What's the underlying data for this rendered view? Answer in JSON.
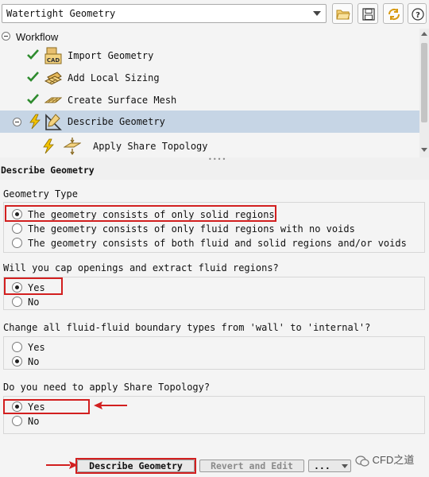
{
  "toolbar": {
    "workflow_select_value": "Watertight Geometry",
    "icons": [
      "open-folder-icon",
      "save-icon",
      "refresh-icon",
      "help-icon"
    ]
  },
  "tree": {
    "root_label": "Workflow",
    "items": [
      {
        "label": "Import Geometry",
        "status": "done",
        "icon": "cad-import-icon"
      },
      {
        "label": "Add Local Sizing",
        "status": "done",
        "icon": "local-sizing-icon"
      },
      {
        "label": "Create Surface Mesh",
        "status": "done",
        "icon": "surface-mesh-icon"
      },
      {
        "label": "Describe Geometry",
        "status": "pending",
        "icon": "describe-geometry-icon",
        "selected": true
      },
      {
        "label": "Apply Share Topology",
        "status": "pending",
        "icon": "share-topology-icon"
      }
    ]
  },
  "panel": {
    "title": "Describe Geometry",
    "geometry_type": {
      "label": "Geometry Type",
      "options": [
        "The geometry consists of only solid regions",
        "The geometry consists of only fluid regions with no voids",
        "The geometry consists of both fluid and solid regions and/or voids"
      ],
      "selected_index": 0
    },
    "cap_openings": {
      "label": "Will you cap openings and extract fluid regions?",
      "options": [
        "Yes",
        "No"
      ],
      "selected_index": 0
    },
    "boundary_types": {
      "label": "Change all fluid-fluid boundary types from 'wall' to 'internal'?",
      "options": [
        "Yes",
        "No"
      ],
      "selected_index": 1
    },
    "share_topology": {
      "label": "Do you need to apply Share Topology?",
      "options": [
        "Yes",
        "No"
      ],
      "selected_index": 0
    }
  },
  "buttons": {
    "describe": "Describe Geometry",
    "revert": "Revert and Edit",
    "more": "..."
  },
  "watermark": "CFD之道",
  "colors": {
    "highlight_red": "#d21f1f",
    "selection_blue": "#c6d5e5",
    "check_green": "#2e8b2e",
    "bolt_yellow": "#f2c200"
  }
}
